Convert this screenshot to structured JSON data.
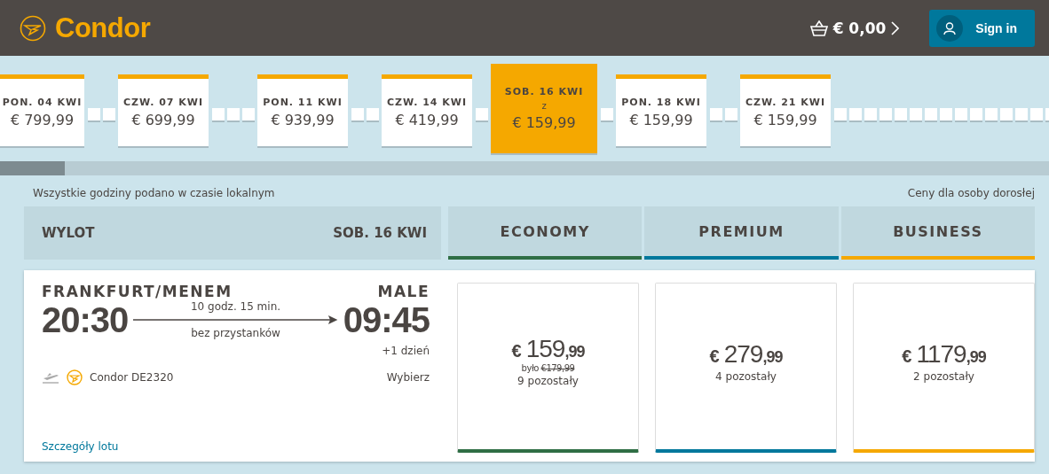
{
  "header": {
    "brand": "Condor",
    "cart_total": "€ 0,00",
    "sign_in": "Sign in"
  },
  "dates": [
    {
      "kind": "date",
      "day": "PON. 04 KWI",
      "price": "€ 799,99",
      "selected": false
    },
    {
      "kind": "empty"
    },
    {
      "kind": "empty"
    },
    {
      "kind": "date",
      "day": "CZW. 07 KWI",
      "price": "€ 699,99",
      "selected": false
    },
    {
      "kind": "empty"
    },
    {
      "kind": "empty"
    },
    {
      "kind": "empty"
    },
    {
      "kind": "date",
      "day": "PON. 11 KWI",
      "price": "€ 939,99",
      "selected": false
    },
    {
      "kind": "empty"
    },
    {
      "kind": "empty"
    },
    {
      "kind": "date",
      "day": "CZW. 14 KWI",
      "price": "€ 419,99",
      "selected": false
    },
    {
      "kind": "empty"
    },
    {
      "kind": "date",
      "day": "SOB. 16 KWI",
      "from": "z",
      "price": "€ 159,99",
      "selected": true
    },
    {
      "kind": "empty"
    },
    {
      "kind": "date",
      "day": "PON. 18 KWI",
      "price": "€ 159,99",
      "selected": false
    },
    {
      "kind": "empty"
    },
    {
      "kind": "empty"
    },
    {
      "kind": "date",
      "day": "CZW. 21 KWI",
      "price": "€ 159,99",
      "selected": false
    },
    {
      "kind": "empty"
    },
    {
      "kind": "empty"
    },
    {
      "kind": "empty"
    },
    {
      "kind": "empty"
    },
    {
      "kind": "empty"
    },
    {
      "kind": "empty"
    },
    {
      "kind": "empty"
    },
    {
      "kind": "empty"
    },
    {
      "kind": "empty"
    },
    {
      "kind": "empty"
    },
    {
      "kind": "empty"
    },
    {
      "kind": "empty"
    },
    {
      "kind": "empty"
    },
    {
      "kind": "empty"
    },
    {
      "kind": "empty"
    },
    {
      "kind": "empty"
    }
  ],
  "notes": {
    "left": "Wszystkie godziny podano w czasie lokalnym",
    "right": "Ceny dla osoby dorosłej"
  },
  "flight_header": {
    "label": "WYLOT",
    "date": "SOB. 16 KWI"
  },
  "fare_classes": [
    {
      "name": "ECONOMY",
      "color": "#2f6e45"
    },
    {
      "name": "PREMIUM",
      "color": "#00789c"
    },
    {
      "name": "BUSINESS",
      "color": "#f5a800"
    }
  ],
  "flight": {
    "origin": "FRANKFURT/MENEM",
    "destination": "MALE",
    "departure": "20:30",
    "arrival": "09:45",
    "duration": "10 godz. 15 min.",
    "stops": "bez przystanków",
    "day_offset": "+1 dzień",
    "flight_number": "Condor DE2320",
    "select": "Wybierz",
    "details_link": "Szczegóły lotu"
  },
  "fares": [
    {
      "currency": "€",
      "amount": "159",
      "cents": ",99",
      "was_label": "było",
      "old_price": "€179,99",
      "seats": "9 pozostały",
      "color": "#2f6e45"
    },
    {
      "currency": "€",
      "amount": "279",
      "cents": ",99",
      "seats": "4 pozostały",
      "color": "#00789c"
    },
    {
      "currency": "€",
      "amount": "1179",
      "cents": ",99",
      "seats": "2 pozostały",
      "color": "#f5a800"
    }
  ]
}
